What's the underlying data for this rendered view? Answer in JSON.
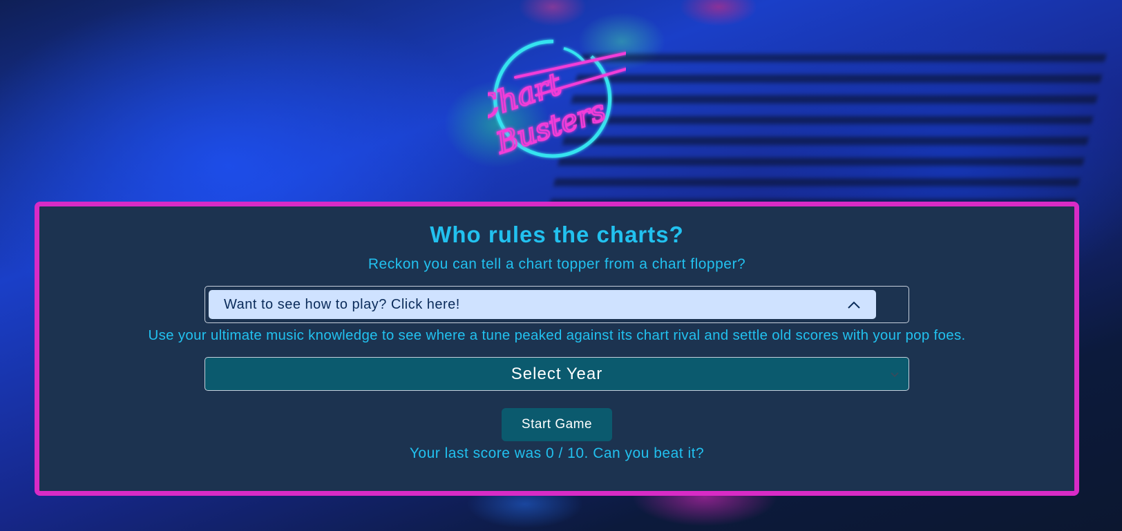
{
  "logo": {
    "line1": "Chart",
    "line2": "Busters",
    "colors": {
      "ring": "#35e3f0",
      "text": "#f23dd8"
    }
  },
  "panel": {
    "title": "Who rules the charts?",
    "subtitle": "Reckon you can tell a chart topper from a chart flopper?",
    "howto": {
      "label": "Want to see how to play? Click here!",
      "icon": "chevron-up-icon"
    },
    "description": "Use your ultimate music knowledge to see where a tune peaked against its chart rival and settle old scores with your pop foes.",
    "year_select": {
      "selected": "Select Year",
      "icon": "chevron-down-icon"
    },
    "start_button": "Start Game",
    "last_score": "Your last score was 0 / 10. Can you beat it?"
  },
  "colors": {
    "accent": "#22c1ef",
    "panel_border": "#d82bc6",
    "panel_bg": "#1c3350",
    "button_bg": "#0b5a6e",
    "howto_bg": "#cfe2ff"
  }
}
